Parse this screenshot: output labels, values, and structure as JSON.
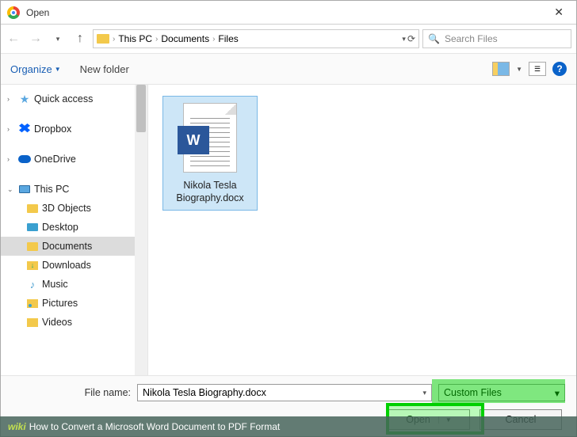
{
  "titlebar": {
    "title": "Open"
  },
  "breadcrumb": {
    "items": [
      "This PC",
      "Documents",
      "Files"
    ]
  },
  "search": {
    "placeholder": "Search Files"
  },
  "toolbar": {
    "organize": "Organize",
    "newfolder": "New folder"
  },
  "sidebar": {
    "quick": "Quick access",
    "dropbox": "Dropbox",
    "onedrive": "OneDrive",
    "pc": "This PC",
    "children": {
      "obj3d": "3D Objects",
      "desktop": "Desktop",
      "documents": "Documents",
      "downloads": "Downloads",
      "music": "Music",
      "pictures": "Pictures",
      "videos": "Videos"
    }
  },
  "file": {
    "name": "Nikola Tesla Biography.docx"
  },
  "footer": {
    "label": "File name:",
    "value": "Nikola Tesla Biography.docx",
    "filter": "Custom Files",
    "open": "Open",
    "cancel": "Cancel"
  },
  "caption": {
    "wiki": "wiki",
    "text": "How to Convert a Microsoft Word Document to PDF Format"
  }
}
